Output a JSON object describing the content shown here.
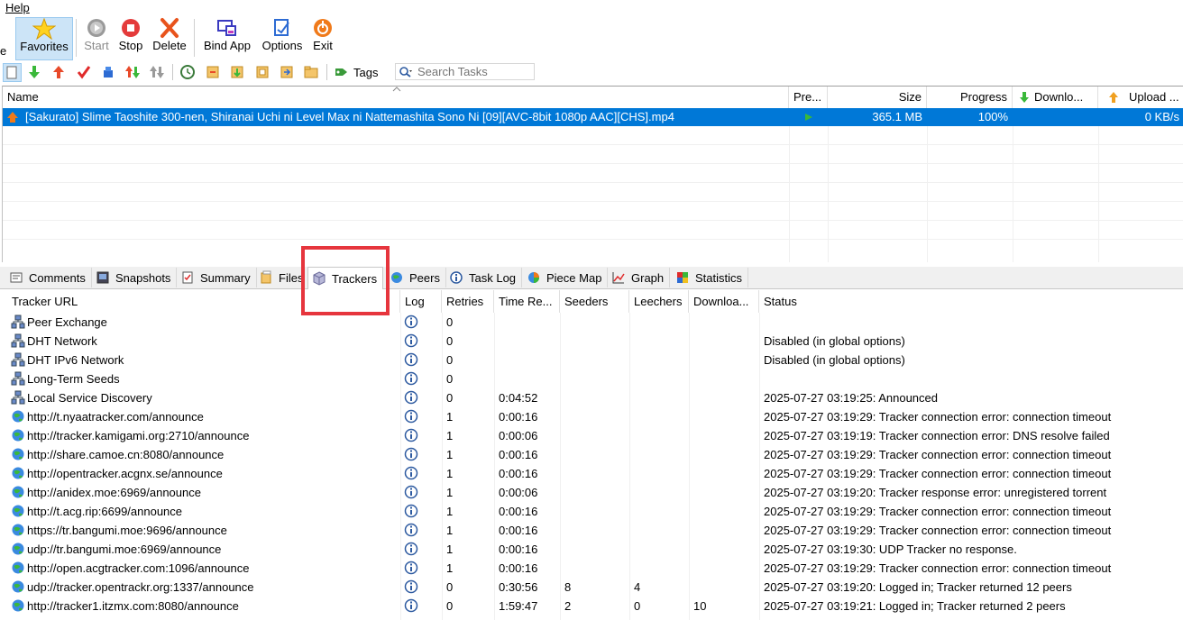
{
  "menu": {
    "help": "Help"
  },
  "toolbar": {
    "favorites": "Favorites",
    "start": "Start",
    "stop": "Stop",
    "delete": "Delete",
    "bind_app": "Bind App",
    "options": "Options",
    "exit": "Exit",
    "tags": "Tags",
    "search_placeholder": "Search Tasks"
  },
  "tasks": {
    "headers": {
      "name": "Name",
      "preview": "Pre...",
      "size": "Size",
      "progress": "Progress",
      "download": "Downlo...",
      "upload": "Upload ..."
    },
    "rows": [
      {
        "name": "[Sakurato] Slime Taoshite 300-nen, Shiranai Uchi ni Level Max ni Nattemashita Sono Ni [09][AVC-8bit 1080p AAC][CHS].mp4",
        "size": "365.1 MB",
        "progress": "100%",
        "download": "",
        "upload": "0 KB/s"
      }
    ]
  },
  "tabs": [
    "Comments",
    "Snapshots",
    "Summary",
    "Files",
    "Trackers",
    "Peers",
    "Task Log",
    "Piece Map",
    "Graph",
    "Statistics"
  ],
  "trackers": {
    "headers": {
      "url": "Tracker URL",
      "log": "Log",
      "retries": "Retries",
      "time": "Time Re...",
      "seeders": "Seeders",
      "leechers": "Leechers",
      "downloads": "Downloa...",
      "status": "Status"
    },
    "rows": [
      {
        "url": "Peer Exchange",
        "retries": "0",
        "time": "",
        "seeders": "",
        "leechers": "",
        "downloads": "",
        "status": "",
        "kind": "network"
      },
      {
        "url": "DHT Network",
        "retries": "0",
        "time": "",
        "seeders": "",
        "leechers": "",
        "downloads": "",
        "status": "Disabled (in global options)",
        "kind": "network"
      },
      {
        "url": "DHT IPv6 Network",
        "retries": "0",
        "time": "",
        "seeders": "",
        "leechers": "",
        "downloads": "",
        "status": "Disabled (in global options)",
        "kind": "network"
      },
      {
        "url": "Long-Term Seeds",
        "retries": "0",
        "time": "",
        "seeders": "",
        "leechers": "",
        "downloads": "",
        "status": "",
        "kind": "network"
      },
      {
        "url": "Local Service Discovery",
        "retries": "0",
        "time": "0:04:52",
        "seeders": "",
        "leechers": "",
        "downloads": "",
        "status": "2025-07-27 03:19:25: Announced",
        "kind": "network"
      },
      {
        "url": "http://t.nyaatracker.com/announce",
        "retries": "1",
        "time": "0:00:16",
        "seeders": "",
        "leechers": "",
        "downloads": "",
        "status": "2025-07-27 03:19:29: Tracker connection error: connection timeout",
        "kind": "globe"
      },
      {
        "url": "http://tracker.kamigami.org:2710/announce",
        "retries": "1",
        "time": "0:00:06",
        "seeders": "",
        "leechers": "",
        "downloads": "",
        "status": "2025-07-27 03:19:19: Tracker connection error: DNS resolve failed",
        "kind": "globe"
      },
      {
        "url": "http://share.camoe.cn:8080/announce",
        "retries": "1",
        "time": "0:00:16",
        "seeders": "",
        "leechers": "",
        "downloads": "",
        "status": "2025-07-27 03:19:29: Tracker connection error: connection timeout",
        "kind": "globe"
      },
      {
        "url": "http://opentracker.acgnx.se/announce",
        "retries": "1",
        "time": "0:00:16",
        "seeders": "",
        "leechers": "",
        "downloads": "",
        "status": "2025-07-27 03:19:29: Tracker connection error: connection timeout",
        "kind": "globe"
      },
      {
        "url": "http://anidex.moe:6969/announce",
        "retries": "1",
        "time": "0:00:06",
        "seeders": "",
        "leechers": "",
        "downloads": "",
        "status": "2025-07-27 03:19:20: Tracker response error: unregistered torrent",
        "kind": "globe"
      },
      {
        "url": "http://t.acg.rip:6699/announce",
        "retries": "1",
        "time": "0:00:16",
        "seeders": "",
        "leechers": "",
        "downloads": "",
        "status": "2025-07-27 03:19:29: Tracker connection error: connection timeout",
        "kind": "globe"
      },
      {
        "url": "https://tr.bangumi.moe:9696/announce",
        "retries": "1",
        "time": "0:00:16",
        "seeders": "",
        "leechers": "",
        "downloads": "",
        "status": "2025-07-27 03:19:29: Tracker connection error: connection timeout",
        "kind": "globe"
      },
      {
        "url": "udp://tr.bangumi.moe:6969/announce",
        "retries": "1",
        "time": "0:00:16",
        "seeders": "",
        "leechers": "",
        "downloads": "",
        "status": "2025-07-27 03:19:30: UDP Tracker no response.",
        "kind": "globe"
      },
      {
        "url": "http://open.acgtracker.com:1096/announce",
        "retries": "1",
        "time": "0:00:16",
        "seeders": "",
        "leechers": "",
        "downloads": "",
        "status": "2025-07-27 03:19:29: Tracker connection error: connection timeout",
        "kind": "globe"
      },
      {
        "url": "udp://tracker.opentrackr.org:1337/announce",
        "retries": "0",
        "time": "0:30:56",
        "seeders": "8",
        "leechers": "4",
        "downloads": "",
        "status": "2025-07-27 03:19:20: Logged in; Tracker returned 12 peers",
        "kind": "globe"
      },
      {
        "url": "http://tracker1.itzmx.com:8080/announce",
        "retries": "0",
        "time": "1:59:47",
        "seeders": "2",
        "leechers": "0",
        "downloads": "10",
        "status": "2025-07-27 03:19:21: Logged in; Tracker returned 2 peers",
        "kind": "globe"
      }
    ]
  }
}
